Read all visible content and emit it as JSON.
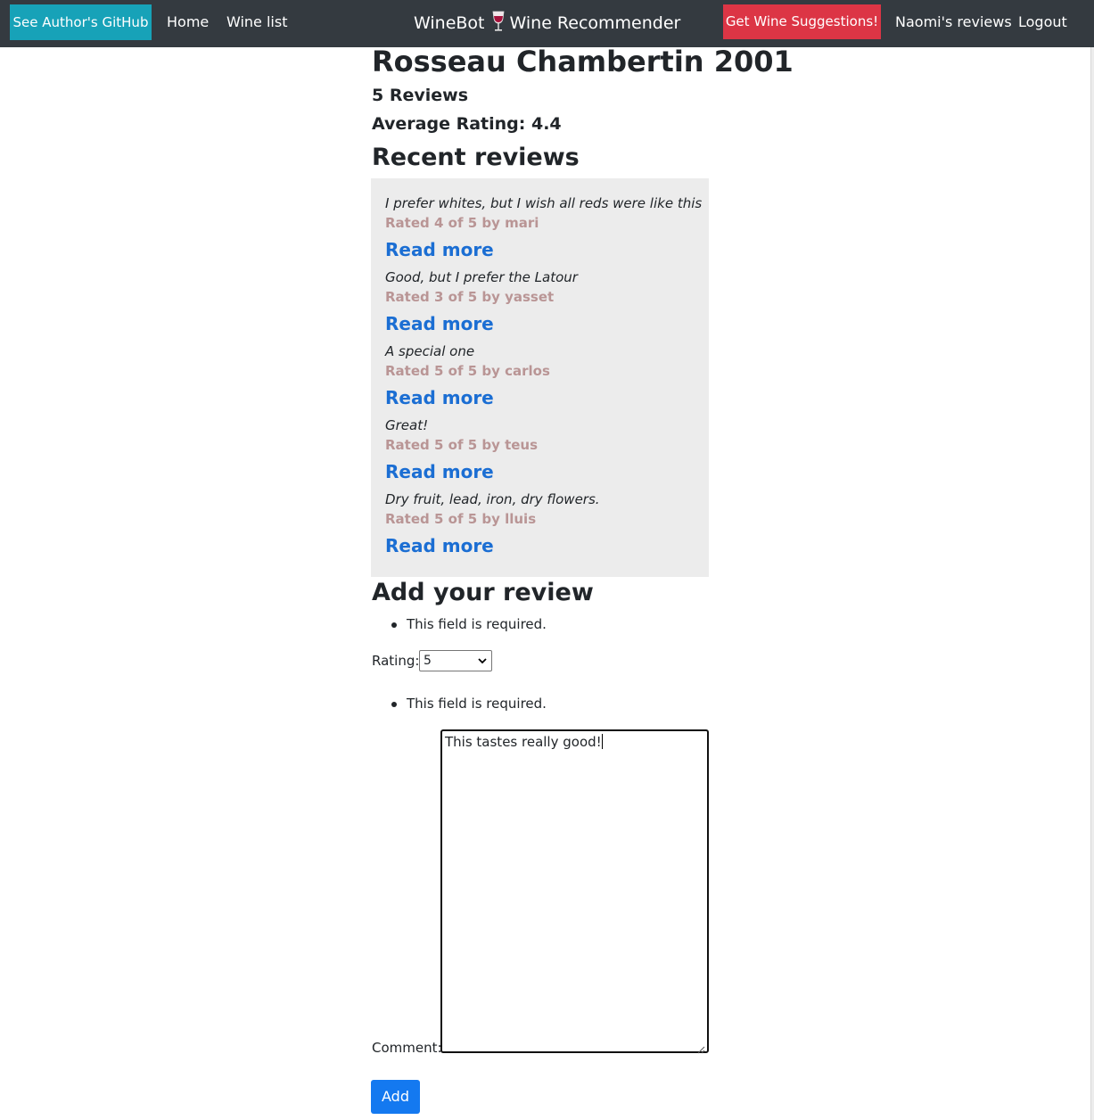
{
  "nav": {
    "github_label": "See Author's GitHub",
    "home_label": "Home",
    "wine_list_label": "Wine list",
    "brand_prefix": "WineBot",
    "brand_suffix": "Wine Recommender",
    "suggest_label": "Get Wine Suggestions!",
    "user_reviews_label": "Naomi's reviews",
    "logout_label": "Logout"
  },
  "wine": {
    "title": "Rosseau Chambertin 2001",
    "review_count": "5 Reviews",
    "average": "Average Rating: 4.4"
  },
  "recent": {
    "heading": "Recent reviews",
    "read_more": "Read more",
    "items": [
      {
        "text": "I prefer whites, but I wish all reds were like this",
        "meta": "Rated 4 of 5 by mari"
      },
      {
        "text": "Good, but I prefer the Latour",
        "meta": "Rated 3 of 5 by yasset"
      },
      {
        "text": "A special one",
        "meta": "Rated 5 of 5 by carlos"
      },
      {
        "text": "Great!",
        "meta": "Rated 5 of 5 by teus"
      },
      {
        "text": "Dry fruit, lead, iron, dry flowers.",
        "meta": "Rated 5 of 5 by lluis"
      }
    ]
  },
  "form": {
    "heading": "Add your review",
    "required_error": "This field is required.",
    "rating_label": "Rating:",
    "rating_value": "5",
    "comment_label": "Comment:",
    "comment_value": "This tastes really good!",
    "submit_label": "Add"
  },
  "colors": {
    "navbar": "#343a40",
    "github_button": "#17a2b8",
    "suggest_button": "#dc3545",
    "link": "#1b6ed3",
    "meta": "#b99595",
    "primary": "#1479f0"
  }
}
